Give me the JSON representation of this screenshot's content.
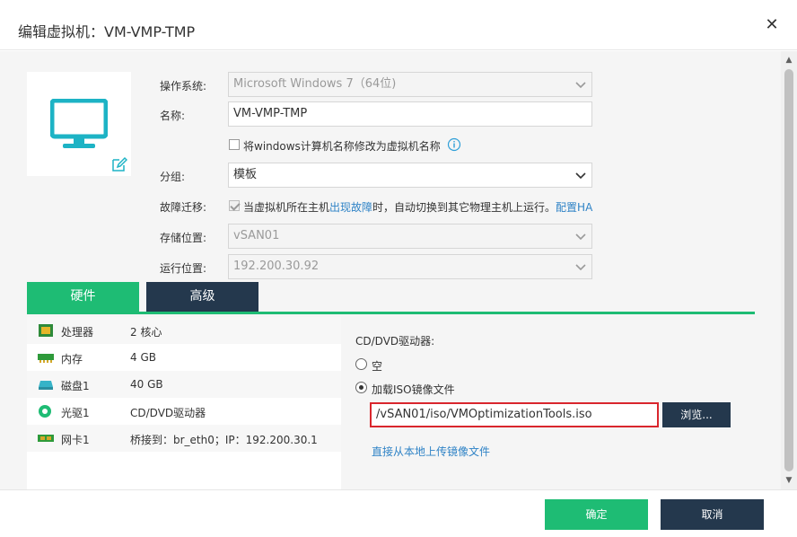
{
  "dialog": {
    "title": "编辑虚拟机：VM-VMP-TMP",
    "close_symbol": "✕"
  },
  "form": {
    "os_label": "操作系统:",
    "os_value": "Microsoft Windows 7（64位)",
    "name_label": "名称:",
    "name_value": "VM-VMP-TMP",
    "rename_checkbox_label": "将windows计算机名称修改为虚拟机名称",
    "group_label": "分组:",
    "group_value": "模板",
    "failover_label": "故障迁移:",
    "failover_text_1": "当虚拟机所在主机",
    "failover_text_link": "出现故障",
    "failover_text_2": "时，自动切换到其它物理主机上运行。",
    "failover_config_link": "配置HA",
    "storage_label": "存储位置:",
    "storage_value": "vSAN01",
    "run_label": "运行位置:",
    "run_value": "192.200.30.92"
  },
  "tabs": [
    {
      "label": "硬件",
      "active": true
    },
    {
      "label": "高级",
      "active": false
    }
  ],
  "hardware": [
    {
      "name": "处理器",
      "value": "2 核心",
      "icon": "cpu-icon"
    },
    {
      "name": "内存",
      "value": "4 GB",
      "icon": "memory-icon"
    },
    {
      "name": "磁盘1",
      "value": "40 GB",
      "icon": "disk-icon"
    },
    {
      "name": "光驱1",
      "value": "CD/DVD驱动器",
      "icon": "cdrom-icon"
    },
    {
      "name": "网卡1",
      "value": "桥接到：br_eth0；IP：192.200.30.1",
      "icon": "nic-icon"
    }
  ],
  "detail": {
    "heading": "CD/DVD驱动器:",
    "option_empty": "空",
    "option_iso": "加载ISO镜像文件",
    "iso_path": "/vSAN01/iso/VMOptimizationTools.iso",
    "browse_label": "浏览...",
    "upload_link": "直接从本地上传镜像文件"
  },
  "footer": {
    "ok_label": "确定",
    "cancel_label": "取消"
  },
  "colors": {
    "accent_green": "#1ebc74",
    "dark_navy": "#24384d",
    "link_blue": "#2f83c6",
    "highlight_red": "#d9262d"
  }
}
